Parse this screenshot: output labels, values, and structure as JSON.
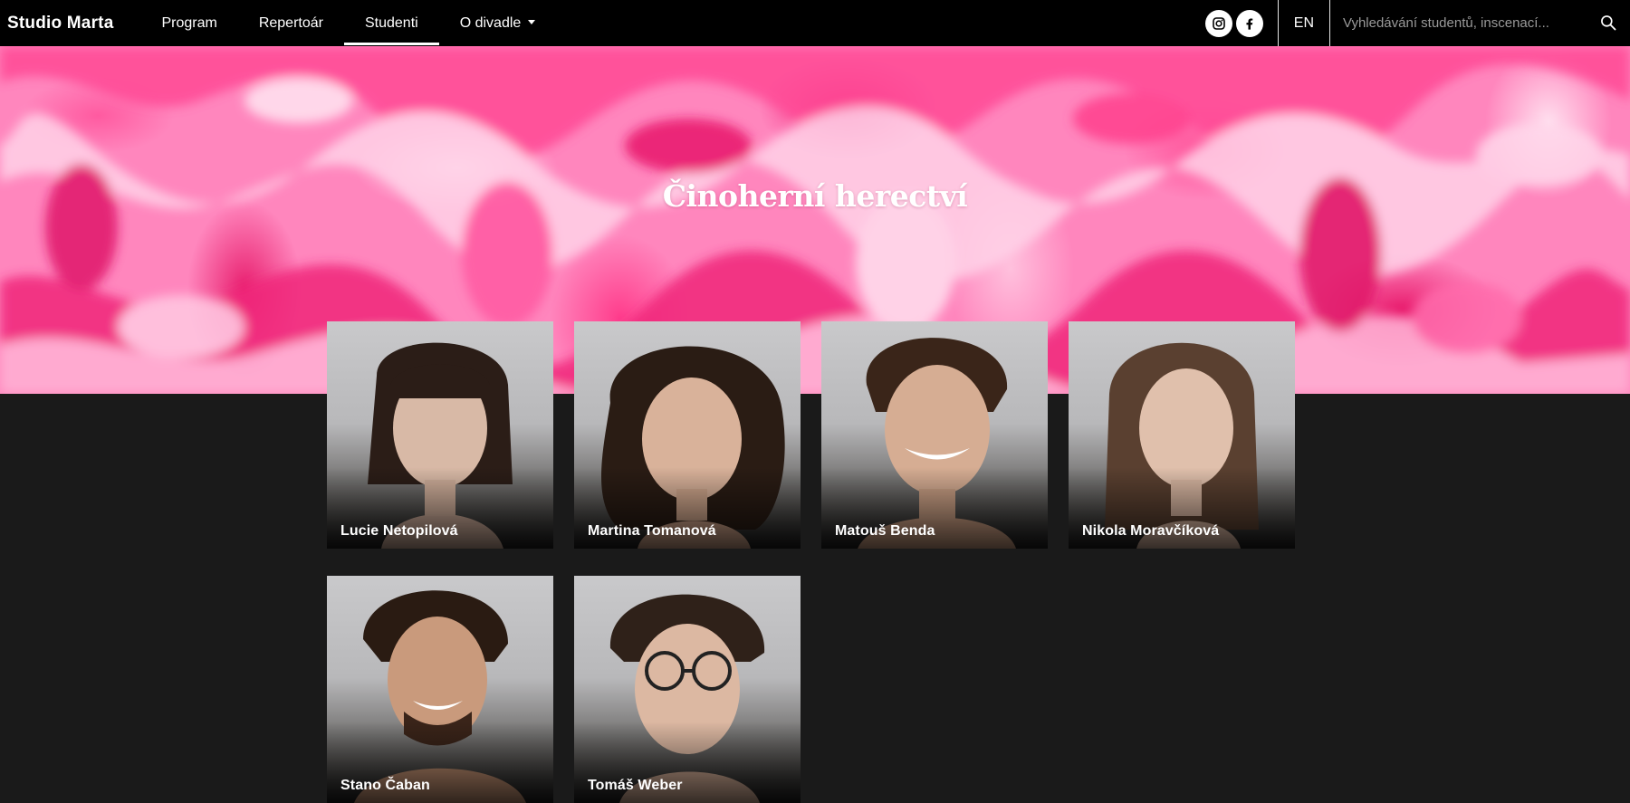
{
  "navbar": {
    "brand": "Studio Marta",
    "items": [
      {
        "label": "Program",
        "active": false
      },
      {
        "label": "Repertoár",
        "active": true
      },
      {
        "label": "Studenti",
        "active": true
      },
      {
        "label": "O divadle",
        "active": false,
        "dropdown": true
      }
    ],
    "social": [
      {
        "icon": "instagram-icon"
      },
      {
        "icon": "facebook-icon"
      }
    ],
    "lang": "EN",
    "search": {
      "placeholder": "Vyhledávání studentů, inscenací...",
      "value": "",
      "icon": "search-icon"
    }
  },
  "hero": {
    "title": "Činoherní herectví"
  },
  "students": [
    {
      "name": "Lucie Netopilová"
    },
    {
      "name": "Martina Tomanová"
    },
    {
      "name": "Matouš Benda"
    },
    {
      "name": "Nikola Moravčíková"
    },
    {
      "name": "Stano Čaban"
    },
    {
      "name": "Tomáš Weber"
    }
  ],
  "colors": {
    "navbar": "#000000",
    "page_background": "#1a1a1a",
    "hero_pink": "#ff86bd",
    "hero_magenta": "#e8206f"
  }
}
